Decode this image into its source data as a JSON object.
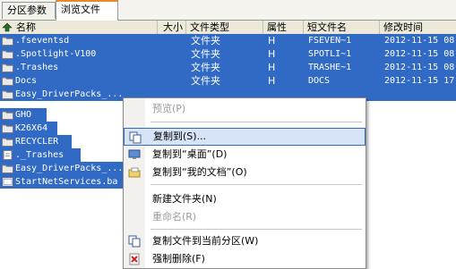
{
  "tabs": [
    "分区参数",
    "浏览文件"
  ],
  "columns": {
    "name": "名称",
    "size": "大小",
    "type": "文件类型",
    "attr": "属性",
    "short": "短文件名",
    "modified": "修改时间"
  },
  "rows": [
    {
      "name": ".fseventsd",
      "type": "文件夹",
      "attr": "H",
      "short": "FSEVEN~1",
      "modified": "2012-11-15 08",
      "icon": "folder-icon"
    },
    {
      "name": ".Spotlight-V100",
      "type": "文件夹",
      "attr": "H",
      "short": "SPOTLI~1",
      "modified": "2012-11-15 08",
      "icon": "folder-icon"
    },
    {
      "name": ".Trashes",
      "type": "文件夹",
      "attr": "H",
      "short": "TRASHE~1",
      "modified": "2012-11-15 08",
      "icon": "folder-icon"
    },
    {
      "name": "Docs",
      "type": "文件夹",
      "attr": "H",
      "short": "DOCS",
      "modified": "2012-11-15 17",
      "icon": "folder-icon"
    },
    {
      "name": "Easy_DriverPacks_...",
      "type": "",
      "attr": "",
      "short": "",
      "modified": "",
      "icon": "folder-icon"
    },
    {
      "name": "GHO",
      "type": "",
      "attr": "",
      "short": "",
      "modified": "",
      "icon": "folder-icon"
    },
    {
      "name": "K26X64",
      "type": "",
      "attr": "",
      "short": "",
      "modified": "",
      "icon": "folder-icon"
    },
    {
      "name": "RECYCLER",
      "type": "",
      "attr": "",
      "short": "",
      "modified": "",
      "icon": "folder-icon"
    },
    {
      "name": "._Trashes",
      "type": "",
      "attr": "",
      "short": "",
      "modified": "",
      "icon": "file-icon"
    },
    {
      "name": "Easy_DriverPacks_...",
      "type": "",
      "attr": "",
      "short": "",
      "modified": "",
      "icon": "folder-icon"
    },
    {
      "name": "StartNetServices.ba",
      "type": "",
      "attr": "",
      "short": "",
      "modified": "",
      "icon": "batch-file-icon"
    }
  ],
  "context_menu": [
    {
      "label": "预览(P)",
      "disabled": true,
      "icon": ""
    },
    {
      "label": "复制到(S)...",
      "disabled": false,
      "icon": "copy-icon",
      "highlighted": true
    },
    {
      "label": "复制到“桌面”(D)",
      "disabled": false,
      "icon": "desktop-icon"
    },
    {
      "label": "复制到“我的文档”(O)",
      "disabled": false,
      "icon": "documents-icon"
    },
    {
      "label": "新建文件夹(N)",
      "disabled": false,
      "icon": ""
    },
    {
      "label": "重命名(R)",
      "disabled": true,
      "icon": ""
    },
    {
      "label": "复制文件到当前分区(W)",
      "disabled": false,
      "icon": "copy-icon"
    },
    {
      "label": "强制删除(F)",
      "disabled": false,
      "icon": "delete-icon"
    }
  ],
  "colors": {
    "selection": "#316ac5",
    "tab_accent": "#e68b2c",
    "menu_highlight": "#d7e3f7"
  }
}
